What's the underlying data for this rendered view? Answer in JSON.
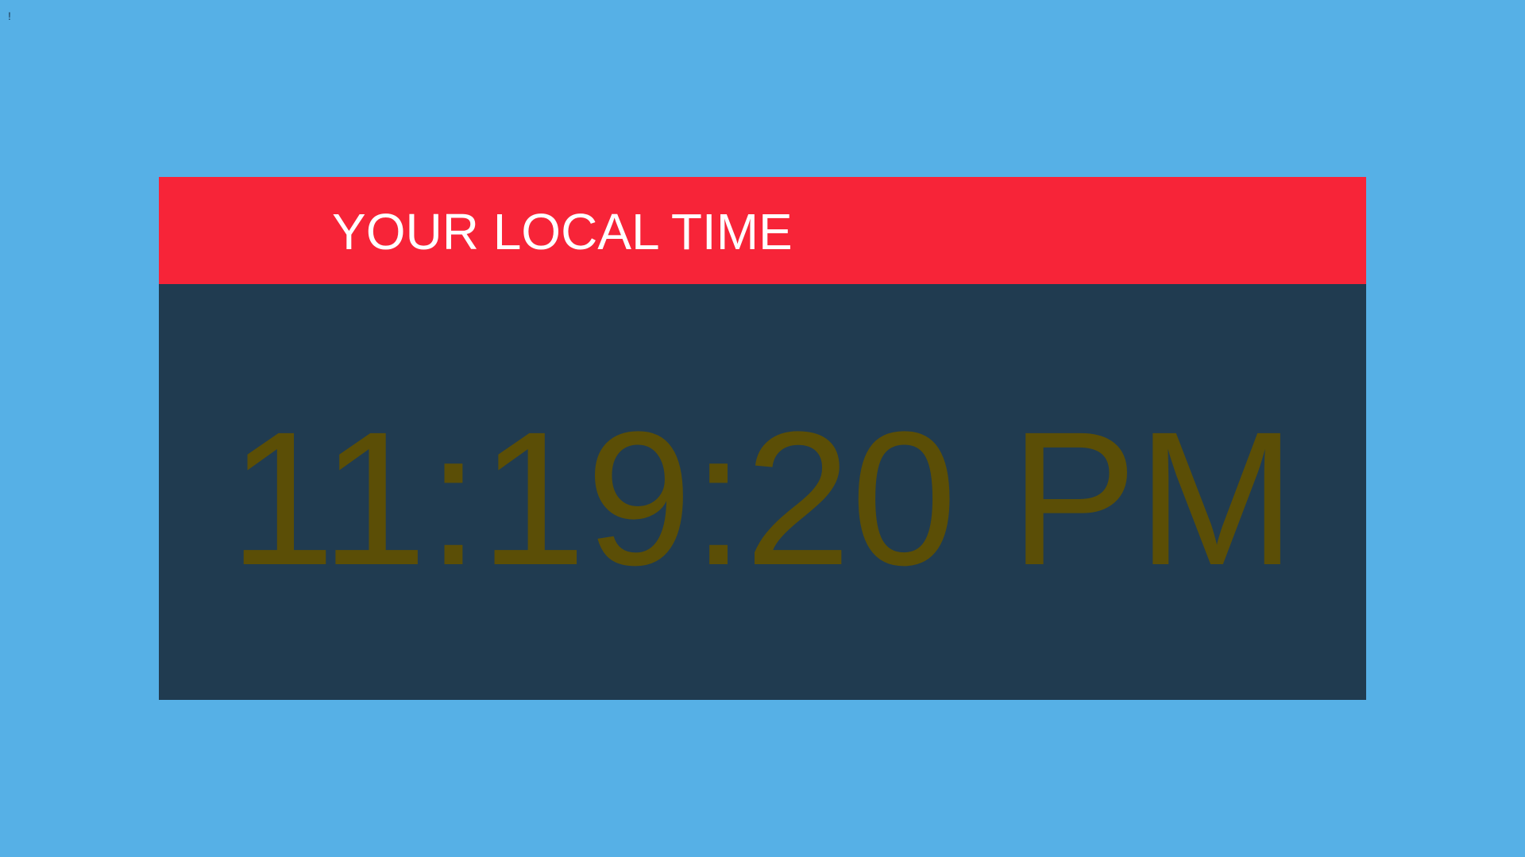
{
  "page": {
    "corner_mark": "!"
  },
  "clock": {
    "title": "YOUR LOCAL TIME",
    "time": "11:19:20 PM"
  },
  "colors": {
    "background": "#56b0e6",
    "header": "#f72438",
    "panel": "#203b50",
    "time_text": "#5b4e06",
    "title_text": "#ffffff"
  }
}
